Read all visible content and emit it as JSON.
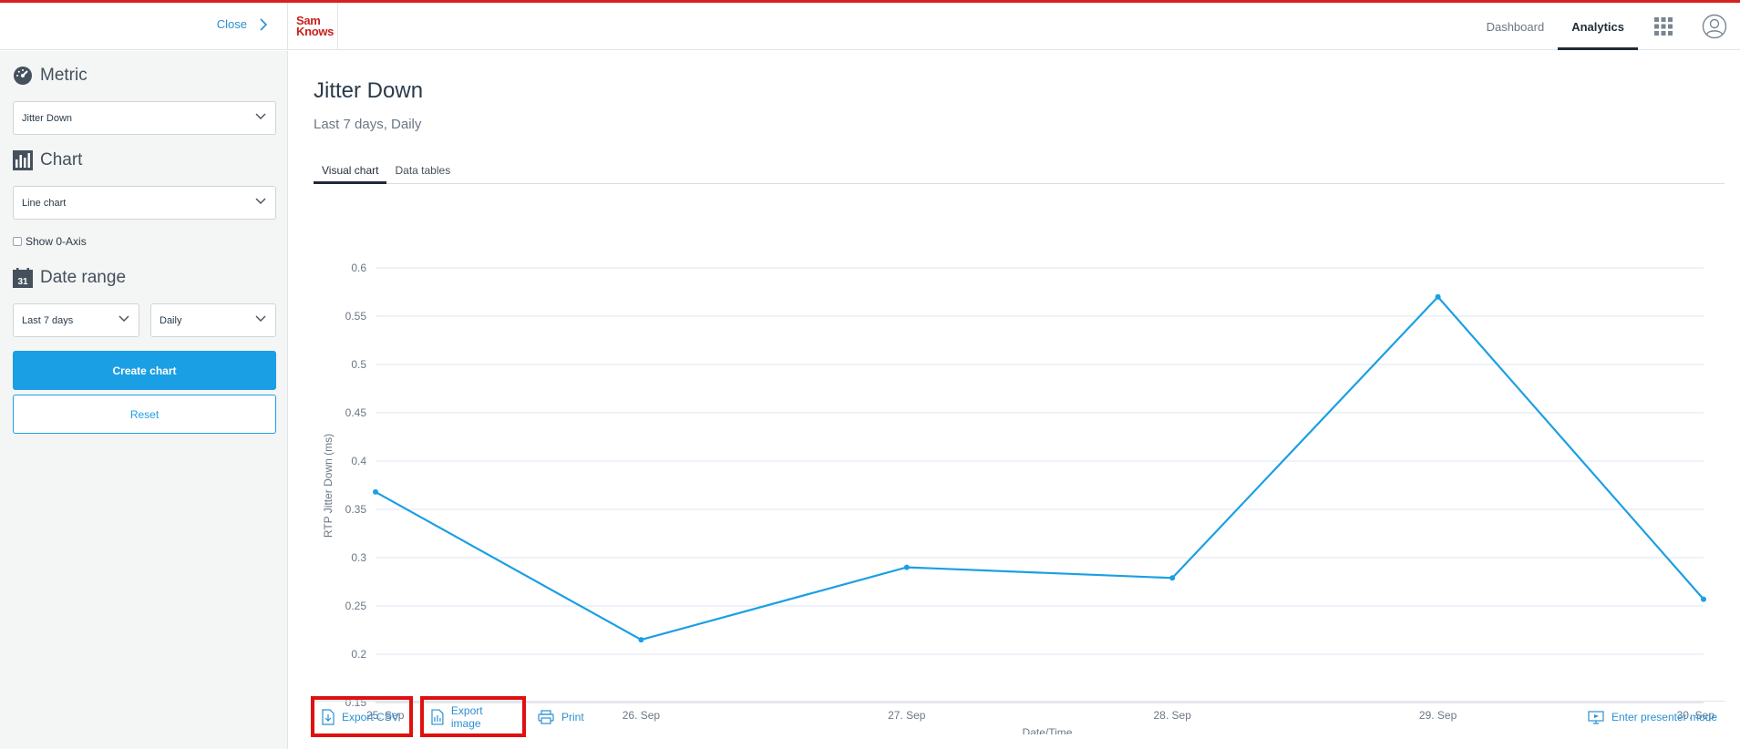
{
  "header": {
    "close_label": "Close",
    "logo_line1": "Sam",
    "logo_line2": "Knows",
    "nav": [
      {
        "label": "Dashboard",
        "active": false
      },
      {
        "label": "Analytics",
        "active": true
      }
    ]
  },
  "sidebar": {
    "metric_title": "Metric",
    "metric_value": "Jitter Down",
    "chart_title": "Chart",
    "chart_value": "Line chart",
    "show_zero_axis": "Show 0-Axis",
    "date_title": "Date range",
    "calendar_day": "31",
    "range_value": "Last 7 days",
    "interval_value": "Daily",
    "create_label": "Create chart",
    "reset_label": "Reset"
  },
  "main": {
    "title": "Jitter Down",
    "subtitle": "Last 7 days, Daily",
    "tabs": [
      {
        "label": "Visual chart",
        "active": true
      },
      {
        "label": "Data tables",
        "active": false
      }
    ],
    "footer": {
      "export_csv": "Export CSV",
      "export_image": "Export image",
      "print": "Print",
      "presenter": "Enter presenter mode"
    }
  },
  "colors": {
    "accent": "#1b9fe4",
    "line": "#1b9fe4",
    "brand": "#c8201c",
    "highlight": "#e01010"
  },
  "chart_data": {
    "type": "line",
    "categories": [
      "25. Sep",
      "26. Sep",
      "27. Sep",
      "28. Sep",
      "29. Sep",
      "30. Sep"
    ],
    "series": [
      {
        "values": [
          0.368,
          0.215,
          0.29,
          0.279,
          0.57,
          0.257
        ]
      }
    ],
    "xlabel": "Date/Time",
    "ylabel": "RTP Jitter Down (ms)",
    "ylim": [
      0.15,
      0.6
    ],
    "yticks": [
      "0.15",
      "0.2",
      "0.25",
      "0.3",
      "0.35",
      "0.4",
      "0.45",
      "0.5",
      "0.55",
      "0.6"
    ],
    "grid": true
  }
}
